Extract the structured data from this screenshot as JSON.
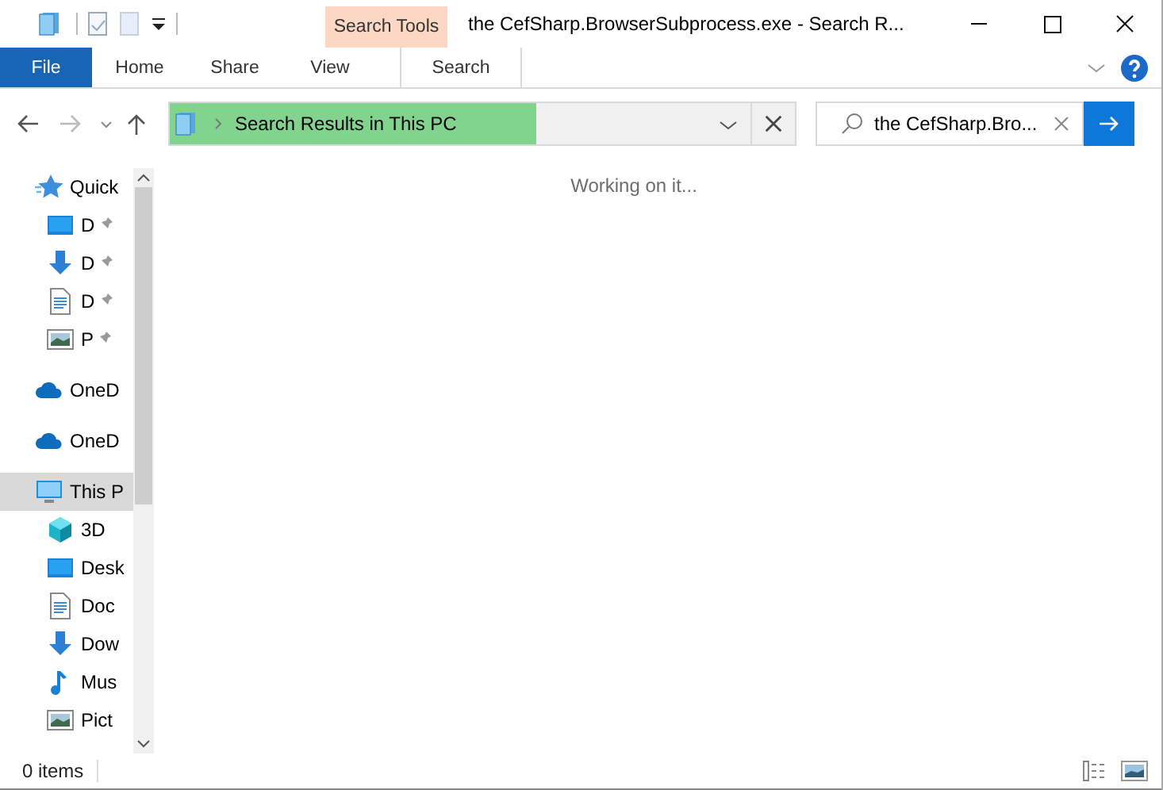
{
  "window": {
    "title": "the CefSharp.BrowserSubprocess.exe - Search R..."
  },
  "context_tab_group": {
    "label": "Search Tools"
  },
  "ribbon_tabs": [
    {
      "label": "File",
      "kind": "file",
      "selected": false
    },
    {
      "label": "Home",
      "kind": "tab",
      "selected": false
    },
    {
      "label": "Share",
      "kind": "tab",
      "selected": false
    },
    {
      "label": "View",
      "kind": "tab",
      "selected": false
    },
    {
      "label": "Search",
      "kind": "context",
      "selected": true
    }
  ],
  "address_bar": {
    "path": "Search Results in This PC",
    "level": 0.63
  },
  "search": {
    "value": "the CefSharp.Bro..."
  },
  "sidebar": {
    "items": [
      {
        "label": "Quick",
        "kind": "star",
        "selected": false,
        "children": [
          {
            "label": "D",
            "kind": "desktop",
            "pinned": true,
            "selected": false
          },
          {
            "label": "D",
            "kind": "download",
            "pinned": true,
            "selected": false
          },
          {
            "label": "D",
            "kind": "document",
            "pinned": true,
            "selected": false
          },
          {
            "label": "P",
            "kind": "pictures",
            "pinned": true,
            "selected": false
          }
        ]
      },
      {
        "label": "OneD",
        "kind": "cloud",
        "selected": false
      },
      {
        "label": "OneD",
        "kind": "cloud",
        "selected": false
      },
      {
        "label": "This P",
        "kind": "pc",
        "selected": true,
        "children": [
          {
            "label": "3D",
            "kind": "cube",
            "pinned": false,
            "selected": false
          },
          {
            "label": "Desk",
            "kind": "desktop",
            "pinned": false,
            "selected": false
          },
          {
            "label": "Doc",
            "kind": "document",
            "pinned": false,
            "selected": false
          },
          {
            "label": "Dow",
            "kind": "download",
            "pinned": false,
            "selected": false
          },
          {
            "label": "Mus",
            "kind": "music",
            "pinned": false,
            "selected": false
          },
          {
            "label": "Pict",
            "kind": "pictures",
            "pinned": false,
            "selected": false
          }
        ]
      }
    ]
  },
  "content": {
    "message": "Working on it..."
  },
  "status_bar": {
    "text": "0 items"
  }
}
